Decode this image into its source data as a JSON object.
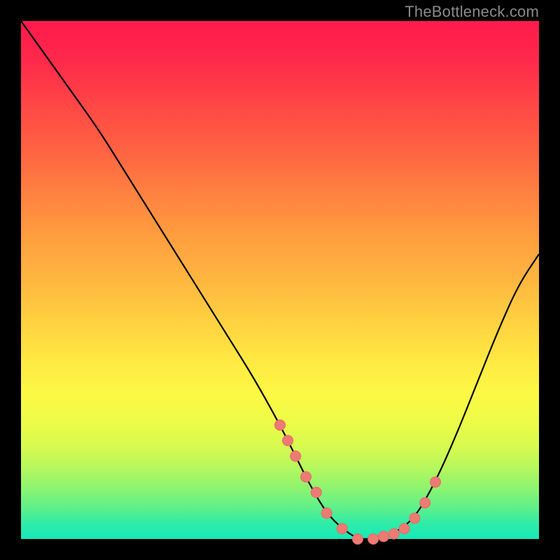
{
  "watermark": "TheBottleneck.com",
  "colors": {
    "page_bg": "#000000",
    "curve": "#000000",
    "marker_fill": "#ee7a74",
    "marker_stroke": "#e56a63",
    "gradient_top": "#ff1a4d",
    "gradient_bottom": "#17e9b8"
  },
  "chart_data": {
    "type": "line",
    "title": "",
    "xlabel": "",
    "ylabel": "",
    "xlim": [
      0,
      100
    ],
    "ylim": [
      0,
      100
    ],
    "grid": false,
    "legend": false,
    "series": [
      {
        "name": "bottleneck-curve",
        "x": [
          0,
          5,
          10,
          15,
          20,
          25,
          30,
          35,
          40,
          45,
          50,
          53,
          56,
          59,
          62,
          65,
          68,
          72,
          76,
          80,
          84,
          88,
          92,
          96,
          100
        ],
        "values": [
          100,
          93,
          86,
          79,
          71,
          63,
          55,
          47,
          39,
          31,
          22,
          16,
          10,
          5,
          2,
          0,
          0,
          1,
          4,
          11,
          20,
          30,
          40,
          49,
          55
        ]
      }
    ],
    "markers": {
      "name": "highlighted-points",
      "x": [
        50,
        51.5,
        53,
        55,
        57,
        59,
        62,
        65,
        68,
        70,
        72,
        74,
        76,
        78,
        80
      ],
      "values": [
        22,
        19,
        16,
        12,
        9,
        5,
        2,
        0,
        0,
        0.5,
        1,
        2,
        4,
        7,
        11
      ]
    }
  }
}
